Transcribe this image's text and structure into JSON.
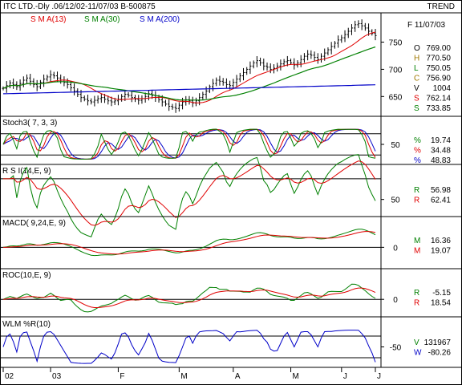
{
  "header": {
    "title": "ITC LTD.-Dly .06/12/02-11/07/03  B-500875",
    "right_label": "TREND"
  },
  "colors": {
    "background": "#ffffff",
    "frame": "#000000",
    "sma13": "#e00000",
    "sma30": "#008000",
    "sma200": "#0000c8",
    "stoch_k": "#008000",
    "stoch_d1": "#e00000",
    "stoch_d2": "#0000c8",
    "oscillator": "#008000",
    "signal": "#e00000",
    "wlm": "#0000c8",
    "info_label_o": "#000000",
    "info_label_h": "#a07800",
    "info_label_l": "#008000",
    "info_label_c": "#a07800",
    "info_label_v": "#000000",
    "info_label_s1": "#e00000",
    "info_label_s2": "#008000"
  },
  "chart_data": [
    {
      "id": "price",
      "type": "ohlc",
      "title": "",
      "legend": [
        {
          "label": "S M A(13)",
          "color": "#e00000"
        },
        {
          "label": "S M A(30)",
          "color": "#008000"
        },
        {
          "label": "S M A(200)",
          "color": "#0000c8"
        }
      ],
      "ylim": [
        618,
        798
      ],
      "yticks": [
        "750",
        "700",
        "650"
      ],
      "ytick_values": [
        750,
        700,
        650
      ],
      "close": [
        665,
        670,
        675,
        672,
        668,
        674,
        680,
        684,
        678,
        672,
        668,
        676,
        682,
        686,
        690,
        688,
        684,
        680,
        676,
        672,
        666,
        660,
        654,
        648,
        645,
        642,
        640,
        643,
        646,
        648,
        645,
        642,
        640,
        642,
        645,
        650,
        654,
        652,
        648,
        645,
        643,
        646,
        650,
        655,
        652,
        648,
        644,
        640,
        636,
        632,
        630,
        628,
        634,
        640,
        644,
        642,
        638,
        642,
        648,
        654,
        660,
        668,
        674,
        680,
        678,
        676,
        672,
        670,
        676,
        682,
        688,
        694,
        700,
        706,
        712,
        716,
        712,
        706,
        704,
        700,
        702,
        706,
        710,
        714,
        716,
        712,
        708,
        712,
        718,
        724,
        728,
        726,
        722,
        718,
        724,
        730,
        736,
        742,
        748,
        754,
        758,
        764,
        770,
        776,
        782,
        784,
        780,
        776,
        770,
        766,
        762
      ],
      "info_block": [
        {
          "label": "O",
          "value": "769.00"
        },
        {
          "label": "H",
          "value": "770.50"
        },
        {
          "label": "L",
          "value": "750.05"
        },
        {
          "label": "C",
          "value": "756.90"
        },
        {
          "label": "V",
          "value": "1004"
        },
        {
          "label": "S",
          "value": "762.14"
        },
        {
          "label": "S",
          "value": "733.85"
        }
      ],
      "date_label": "F 11/07/03"
    },
    {
      "id": "stoch",
      "type": "line",
      "title": "Stoch3( 7, 3, 3)",
      "ylim": [
        0,
        100
      ],
      "reference_lines": [
        20,
        80
      ],
      "yticks": [
        "50"
      ],
      "ytick_values": [
        50
      ],
      "info_block": [
        {
          "label": "%",
          "value": "19.74"
        },
        {
          "label": "%",
          "value": "34.48"
        },
        {
          "label": "%",
          "value": "48.83"
        }
      ]
    },
    {
      "id": "rsi",
      "type": "line",
      "title": "R S I(14,E, 9)",
      "ylim": [
        35,
        80
      ],
      "reference_lines": [
        70
      ],
      "yticks": [
        "50"
      ],
      "ytick_values": [
        50
      ],
      "info_block": [
        {
          "label": "R",
          "value": "56.98"
        },
        {
          "label": "R",
          "value": "62.41"
        }
      ]
    },
    {
      "id": "macd",
      "type": "line",
      "title": "MACD( 9,24,E, 9)",
      "ylim": [
        -25,
        30
      ],
      "reference_lines": [
        0
      ],
      "yticks": [
        "0"
      ],
      "ytick_values": [
        0
      ],
      "info_block": [
        {
          "label": "M",
          "value": "16.36"
        },
        {
          "label": "M",
          "value": "19.07"
        }
      ]
    },
    {
      "id": "roc",
      "type": "line",
      "title": "ROC(10,E, 9)",
      "ylim": [
        -8,
        12
      ],
      "reference_lines": [
        0
      ],
      "yticks": [
        "0"
      ],
      "ytick_values": [
        0
      ],
      "info_block": [
        {
          "label": "R",
          "value": "-5.15"
        },
        {
          "label": "R",
          "value": "18.54"
        }
      ]
    },
    {
      "id": "wlm",
      "type": "line",
      "title": "WLM %R(10)",
      "ylim": [
        -100,
        0
      ],
      "reference_lines": [
        -20,
        -80
      ],
      "yticks": [
        "-50"
      ],
      "ytick_values": [
        -50
      ],
      "info_block": [
        {
          "label": "V",
          "value": "131967"
        },
        {
          "label": "W",
          "value": "-80.26"
        }
      ]
    }
  ],
  "x_axis": {
    "labels": [
      "02",
      "03",
      "F",
      "M",
      "A",
      "M",
      "J",
      "J"
    ],
    "label_indices": [
      0,
      14,
      34,
      52,
      68,
      85,
      100,
      112
    ]
  }
}
